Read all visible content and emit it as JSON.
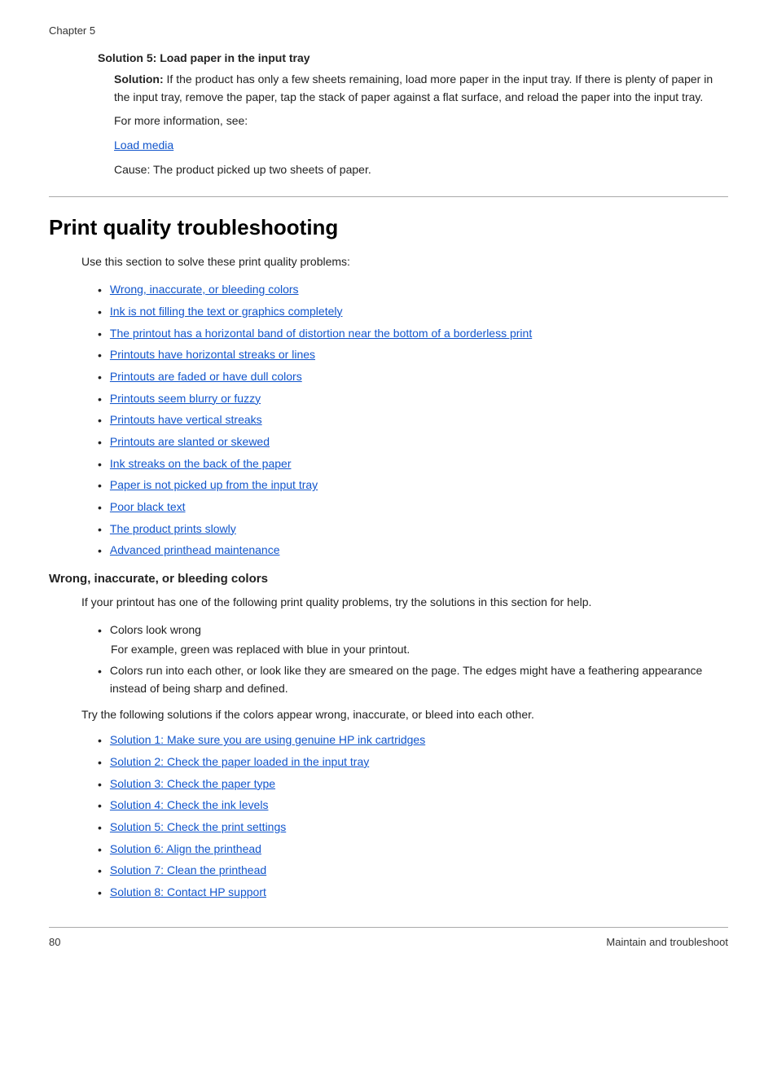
{
  "chapter_label": "Chapter 5",
  "top_section": {
    "solution_header": "Solution 5: Load paper in the input tray",
    "solution_bold": "Solution:",
    "solution_text": "  If the product has only a few sheets remaining, load more paper in the input tray. If there is plenty of paper in the input tray, remove the paper, tap the stack of paper against a flat surface, and reload the paper into the input tray.",
    "for_more_info": "For more information, see:",
    "link_load_media": "Load media",
    "cause_bold": "Cause:",
    "cause_text": "   The product picked up two sheets of paper."
  },
  "print_quality": {
    "title": "Print quality troubleshooting",
    "intro": "Use this section to solve these print quality problems:",
    "links": [
      "Wrong, inaccurate, or bleeding colors",
      "Ink is not filling the text or graphics completely",
      "The printout has a horizontal band of distortion near the bottom of a borderless print",
      "Printouts have horizontal streaks or lines",
      "Printouts are faded or have dull colors",
      "Printouts seem blurry or fuzzy",
      "Printouts have vertical streaks",
      "Printouts are slanted or skewed",
      "Ink streaks on the back of the paper",
      "Paper is not picked up from the input tray",
      "Poor black text",
      "The product prints slowly",
      "Advanced printhead maintenance"
    ]
  },
  "wrong_colors": {
    "header": "Wrong, inaccurate, or bleeding colors",
    "intro": "If your printout has one of the following print quality problems, try the solutions in this section for help.",
    "bullets": [
      {
        "main": "Colors look wrong",
        "sub": "For example, green was replaced with blue in your printout."
      },
      {
        "main": "Colors run into each other, or look like they are smeared on the page. The edges might have a feathering appearance instead of being sharp and defined.",
        "sub": ""
      }
    ],
    "try_text": "Try the following solutions if the colors appear wrong, inaccurate, or bleed into each other.",
    "solutions": [
      "Solution 1: Make sure you are using genuine HP ink cartridges",
      "Solution 2: Check the paper loaded in the input tray",
      "Solution 3: Check the paper type",
      "Solution 4: Check the ink levels",
      "Solution 5: Check the print settings",
      "Solution 6: Align the printhead",
      "Solution 7: Clean the printhead",
      "Solution 8: Contact HP support"
    ]
  },
  "footer": {
    "page_number": "80",
    "section_label": "Maintain and troubleshoot"
  },
  "icons": {
    "bullet": "•"
  }
}
